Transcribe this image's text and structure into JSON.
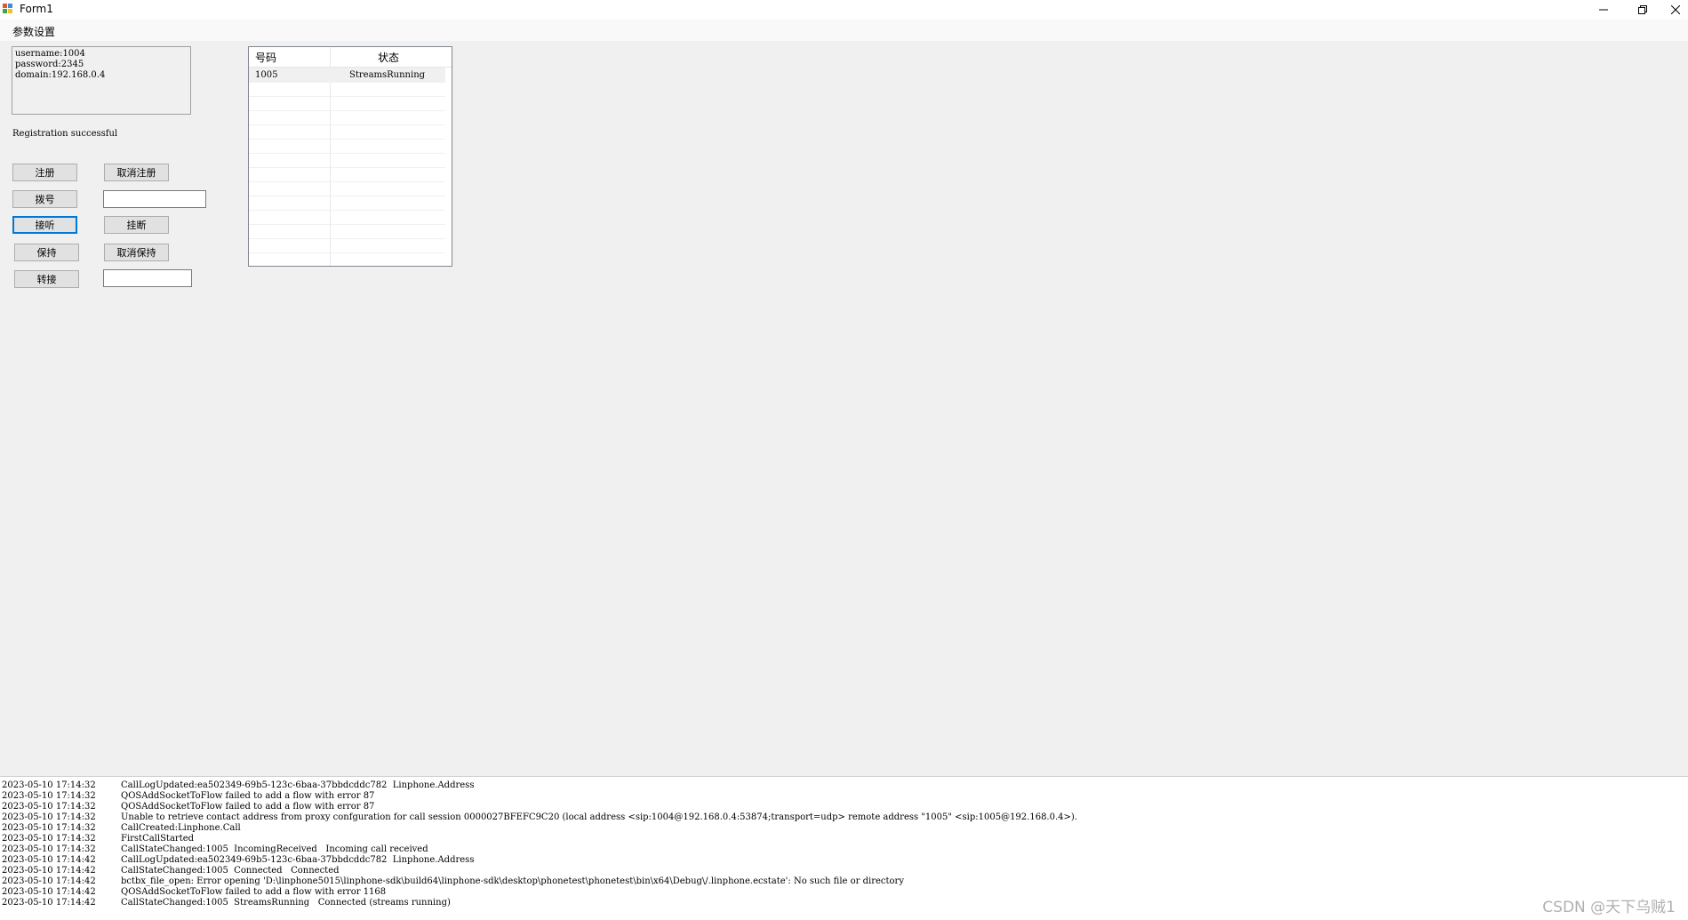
{
  "window": {
    "title": "Form1"
  },
  "menu": {
    "items": [
      "参数设置"
    ]
  },
  "params_text": "username:1004\npassword:2345\ndomain:192.168.0.4",
  "registration_status": "Registration successful",
  "buttons": {
    "register": "注册",
    "unregister": "取消注册",
    "dial": "拨号",
    "answer": "接听",
    "hangup": "挂断",
    "hold": "保持",
    "unhold": "取消保持",
    "transfer": "转接"
  },
  "inputs": {
    "dial_number": "",
    "transfer_number": ""
  },
  "grid": {
    "headers": [
      "号码",
      "状态"
    ],
    "rows": [
      [
        "1005",
        "StreamsRunning"
      ]
    ]
  },
  "log": [
    [
      "2023-05-10 17:14:32",
      "CallLogUpdated:ea502349-69b5-123c-6baa-37bbdcddc782  Linphone.Address"
    ],
    [
      "2023-05-10 17:14:32",
      "QOSAddSocketToFlow failed to add a flow with error 87"
    ],
    [
      "2023-05-10 17:14:32",
      "QOSAddSocketToFlow failed to add a flow with error 87"
    ],
    [
      "2023-05-10 17:14:32",
      "Unable to retrieve contact address from proxy confguration for call session 0000027BFEFC9C20 (local address <sip:1004@192.168.0.4:53874;transport=udp> remote address \"1005\" <sip:1005@192.168.0.4>)."
    ],
    [
      "2023-05-10 17:14:32",
      "CallCreated:Linphone.Call"
    ],
    [
      "2023-05-10 17:14:32",
      "FirstCallStarted"
    ],
    [
      "2023-05-10 17:14:32",
      "CallStateChanged:1005  IncomingReceived   Incoming call received"
    ],
    [
      "2023-05-10 17:14:42",
      "CallLogUpdated:ea502349-69b5-123c-6baa-37bbdcddc782  Linphone.Address"
    ],
    [
      "2023-05-10 17:14:42",
      "CallStateChanged:1005  Connected   Connected"
    ],
    [
      "2023-05-10 17:14:42",
      "bctbx_file_open: Error opening 'D:\\linphone5015\\linphone-sdk\\build64\\linphone-sdk\\desktop\\phonetest\\phonetest\\bin\\x64\\Debug\\/.linphone.ecstate': No such file or directory"
    ],
    [
      "2023-05-10 17:14:42",
      "QOSAddSocketToFlow failed to add a flow with error 1168"
    ],
    [
      "2023-05-10 17:14:42",
      "CallStateChanged:1005  StreamsRunning   Connected (streams running)"
    ]
  ],
  "watermark": "CSDN @天下乌贼1"
}
